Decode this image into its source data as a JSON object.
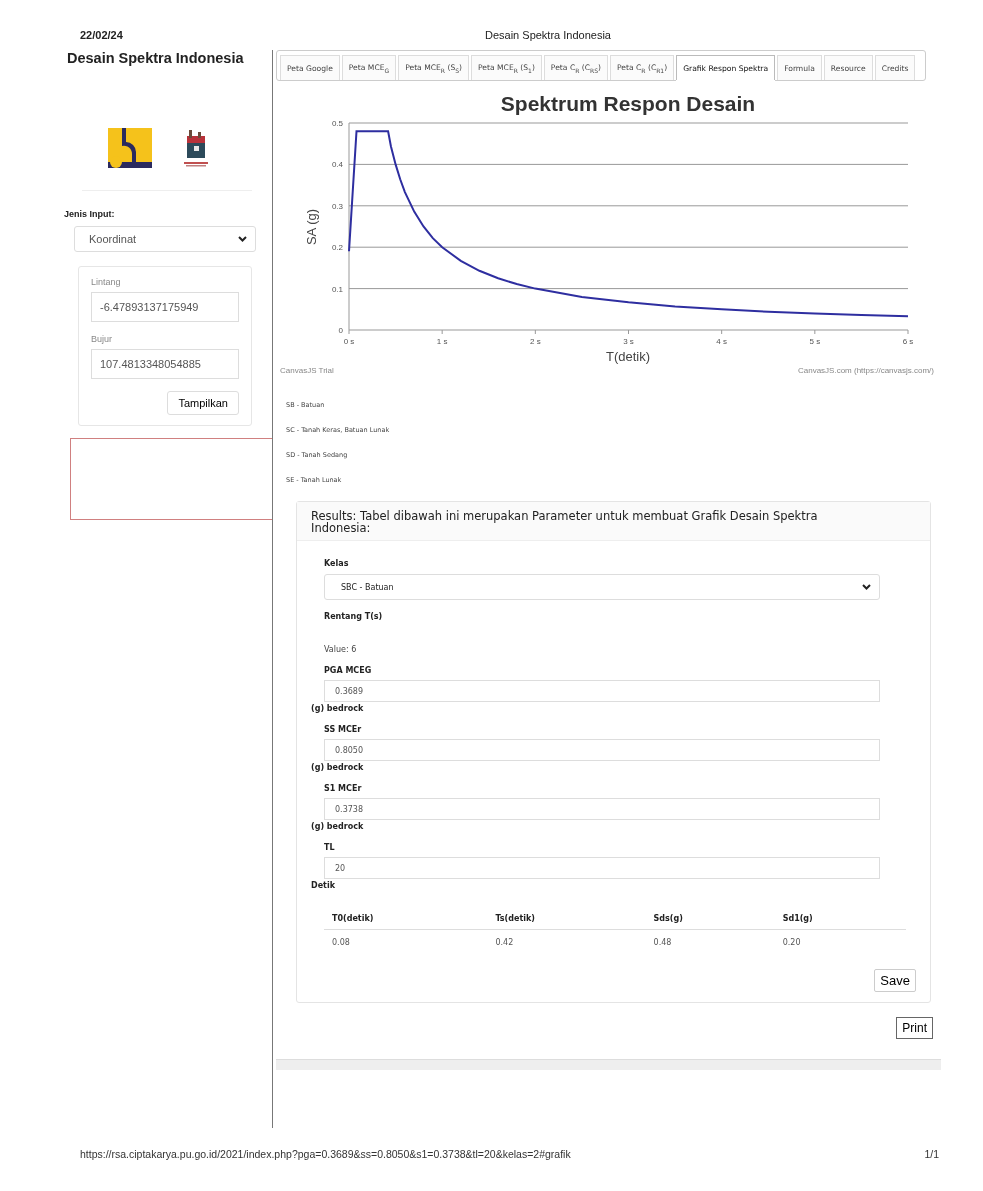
{
  "print_header": {
    "date": "22/02/24",
    "title": "Desain Spektra Indonesia"
  },
  "sidebar": {
    "title": "Desain Spektra Indonesia",
    "input_type_label": "Jenis Input:",
    "input_type_value": "Koordinat",
    "latitude_label": "Lintang",
    "latitude_value": "-6.47893137175949",
    "longitude_label": "Bujur",
    "longitude_value": "107.4813348054885",
    "show_button": "Tampilkan"
  },
  "tabs": [
    {
      "label": "Peta Google",
      "selected": false
    },
    {
      "label": "Peta MCE$_{G}$",
      "selected": false
    },
    {
      "label": "Peta MCE$_{R}$ (S$_{S}$)",
      "selected": false
    },
    {
      "label": "Peta MCE$_{R}$ (S$_{1}$)",
      "selected": false
    },
    {
      "label": "Peta C$_{R}$ (C$_{RS}$)",
      "selected": false
    },
    {
      "label": "Peta C$_{R}$ (C$_{R1}$)",
      "selected": false
    },
    {
      "label": "Grafik Respon Spektra",
      "selected": true
    },
    {
      "label": "Formula",
      "selected": false
    },
    {
      "label": "Resource",
      "selected": false
    },
    {
      "label": "Credits",
      "selected": false
    }
  ],
  "chart": {
    "credit_left": "CanvasJS Trial",
    "credit_right": "CanvasJS.com (https://canvasjs.com/)",
    "chart_data": {
      "type": "line",
      "title": "Spektrum Respon Desain",
      "xlabel": "T(detik)",
      "ylabel": "SA (g)",
      "x": [
        0,
        0.08,
        0.42,
        0.45,
        0.5,
        0.55,
        0.6,
        0.7,
        0.8,
        0.9,
        1,
        1.2,
        1.4,
        1.6,
        1.8,
        2,
        2.5,
        3,
        3.5,
        4,
        4.5,
        5,
        5.5,
        6
      ],
      "series": [
        {
          "color": "#2e2ea0",
          "values": [
            0.19,
            0.48,
            0.48,
            0.444,
            0.4,
            0.364,
            0.333,
            0.286,
            0.25,
            0.222,
            0.2,
            0.167,
            0.143,
            0.125,
            0.111,
            0.1,
            0.08,
            0.067,
            0.057,
            0.05,
            0.044,
            0.04,
            0.036,
            0.033
          ]
        }
      ],
      "grid": true,
      "xlim": [
        0,
        6
      ],
      "ylim": [
        0,
        0.5
      ],
      "xticks": [
        {
          "value": 0,
          "label": "0 s"
        },
        {
          "value": 1,
          "label": "1 s"
        },
        {
          "value": 2,
          "label": "2 s"
        },
        {
          "value": 3,
          "label": "3 s"
        },
        {
          "value": 4,
          "label": "4 s"
        },
        {
          "value": 5,
          "label": "5 s"
        },
        {
          "value": 6,
          "label": "6 s"
        }
      ],
      "yticks": [
        {
          "value": 0,
          "label": "0"
        },
        {
          "value": 0.1,
          "label": "0.1"
        },
        {
          "value": 0.2,
          "label": "0.2"
        },
        {
          "value": 0.3,
          "label": "0.3"
        },
        {
          "value": 0.4,
          "label": "0.4"
        },
        {
          "value": 0.5,
          "label": "0.5"
        }
      ]
    }
  },
  "site_classes": [
    "SB - Batuan",
    "SC - Tanah Keras, Batuan Lunak",
    "SD - Tanah Sedang",
    "SE - Tanah Lunak"
  ],
  "results": {
    "heading": "Results: Tabel dibawah ini merupakan Parameter untuk membuat Grafik Desain Spektra Indonesia:",
    "class_label": "Kelas",
    "class_value": "SBC - Batuan",
    "range_label": "Rentang T(s)",
    "range_value": "Value: 6",
    "fields": [
      {
        "label": "PGA MCEG",
        "value": "0.3689",
        "unit": "(g) bedrock"
      },
      {
        "label": "SS MCEr",
        "value": "0.8050",
        "unit": "(g) bedrock"
      },
      {
        "label": "S1 MCEr",
        "value": "0.3738",
        "unit": "(g) bedrock"
      },
      {
        "label": "TL",
        "value": "20",
        "unit": "Detik"
      }
    ],
    "table": {
      "columns": [
        "T0(detik)",
        "Ts(detik)",
        "Sds(g)",
        "Sd1(g)"
      ],
      "rows": [
        [
          "0.08",
          "0.42",
          "0.48",
          "0.20"
        ]
      ]
    },
    "save_button": "Save"
  },
  "print_button": "Print",
  "print_footer": {
    "url": "https://rsa.ciptakarya.pu.go.id/2021/index.php?pga=0.3689&ss=0.8050&s1=0.3738&tl=20&kelas=2#grafik",
    "page": "1/1"
  }
}
